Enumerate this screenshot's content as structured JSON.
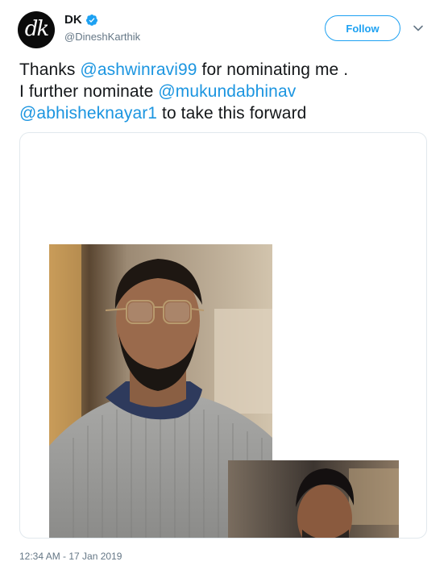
{
  "author": {
    "avatar_text": "dk",
    "display_name": "DK",
    "handle": "@DineshKarthik",
    "verified": true
  },
  "actions": {
    "follow_label": "Follow"
  },
  "tweet": {
    "text_1": "Thanks ",
    "mention_1": "@ashwinravi99",
    "text_2": " for nominating me .",
    "text_3": "I further nominate ",
    "mention_2": "@mukundabhinav",
    "mention_3": "@abhisheknayar1",
    "text_4": " to take this forward"
  },
  "timestamp": "12:34 AM - 17 Jan 2019",
  "colors": {
    "accent": "#1da1f2",
    "link": "#1b95e0",
    "muted": "#657786",
    "border": "#e1e8ed"
  },
  "icons": {
    "verified": "verified-badge-icon",
    "menu": "chevron-down-icon"
  }
}
